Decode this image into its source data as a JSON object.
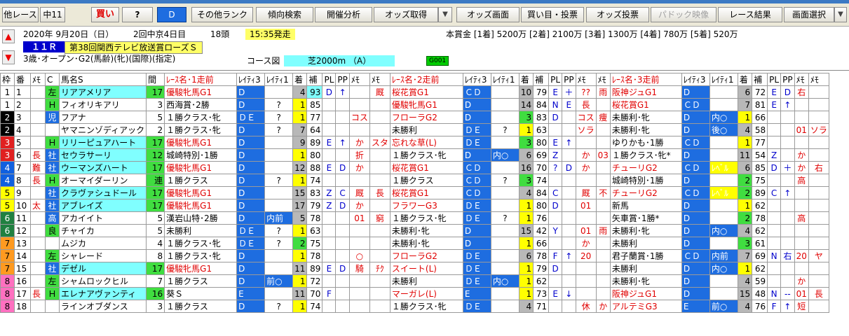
{
  "toolbar": {
    "b0": "他レース",
    "b1": "中11",
    "b2": "買い",
    "b3": "?",
    "b4": "D",
    "b5": "その他ランク",
    "b6": "傾向検索",
    "b7": "開催分析",
    "b8": "オッズ取得",
    "b9": "▼",
    "b10": "オッズ画面",
    "b11": "買い目・投票",
    "b12": "オッズ投票",
    "b13": "パドック映像",
    "b14": "レース結果",
    "b15": "画面選択",
    "b16": "▼"
  },
  "race": {
    "date": "2020年 9月20日（日）",
    "meet": "2回中京4日目",
    "heads": "18頭",
    "post": "15:35発走",
    "num": "１１Ｒ",
    "name": "第38回関西テレビ放送賞ローズＳ",
    "cond": "3歳･オープン･G2(馬齢)(牝)(国際)(指定)",
    "course_lbl": "コース図",
    "course": "芝2000m （A）",
    "code": "G001",
    "prize": "本賞金 [1着] 5200万 [2着] 2100万 [3着] 1300万 [4着] 780万 [5着] 520万"
  },
  "headers": [
    "枠",
    "番",
    "ﾒﾓ",
    "C",
    "馬名S",
    "間",
    "ﾚｰｽ名･1走前",
    "ﾚｲﾃｨ3",
    "ﾚｲﾃｨ1",
    "着",
    "補",
    "PL",
    "PP",
    "ﾒﾓ",
    "ﾒﾓ",
    "ﾚｰｽ名･2走前",
    "ﾚｲﾃｨ3",
    "ﾚｲﾃｨ1",
    "着",
    "補",
    "PL",
    "PP",
    "ﾒﾓ",
    "ﾒﾓ",
    "ﾚｰｽ名･3走前",
    "ﾚｲﾃｨ3",
    "ﾚｲﾃｨ1",
    "着",
    "補",
    "PL",
    "PP",
    "ﾒﾓ",
    "ﾒﾓ"
  ],
  "rows": [
    [
      "1",
      "1",
      "",
      "左",
      "リアアメリア",
      "17",
      "優駿牝馬G1",
      "D",
      "",
      "4",
      "93",
      "D",
      "↑",
      "",
      "厩",
      "桜花賞G1",
      "ＣＤ",
      "",
      "10",
      "79",
      "E",
      "＋",
      "??",
      "雨",
      "阪神ジュG1",
      "D",
      "",
      "6",
      "72",
      "E",
      "D",
      "右",
      ""
    ],
    [
      "1",
      "2",
      "",
      "Ｈ",
      "フィオリキアリ",
      "3",
      "西海賞･2勝",
      "D",
      "?",
      "1",
      "85",
      "",
      "",
      "",
      "",
      "優駿牝馬G1",
      "D",
      "",
      "14",
      "84",
      "N",
      "E",
      "長",
      "",
      "桜花賞G1",
      "ＣＤ",
      "",
      "7",
      "81",
      "E",
      "↑",
      "",
      ""
    ],
    [
      "2",
      "3",
      "",
      "児",
      "フアナ",
      "5",
      "１勝クラス･牝",
      "ＤＥ",
      "?",
      "1",
      "77",
      "",
      "",
      "コス",
      "",
      "フローラG2",
      "D",
      "",
      "3",
      "83",
      "D",
      "",
      "コス",
      "痩",
      "未勝利･牝",
      "D",
      "内○",
      "1",
      "66",
      "",
      "",
      "",
      ""
    ],
    [
      "2",
      "4",
      "",
      "",
      "ヤマニンゾディアック",
      "2",
      "１勝クラス･牝",
      "D",
      "?",
      "7",
      "64",
      "",
      "",
      "",
      "",
      "未勝利",
      "ＤＥ",
      "?",
      "1",
      "63",
      "",
      "",
      "ソラ",
      "",
      "未勝利･牝",
      "D",
      "後○",
      "4",
      "58",
      "",
      "",
      "01",
      "ソラ"
    ],
    [
      "3",
      "5",
      "",
      "Ｈ",
      "リリーピュアハート",
      "17",
      "優駿牝馬G1",
      "D",
      "",
      "9",
      "89",
      "E",
      "↑",
      "か",
      "スタ",
      "忘れな草(L)",
      "ＤＥ",
      "",
      "3",
      "80",
      "E",
      "↑",
      "",
      "",
      "ゆりかも･1勝",
      "ＣＤ",
      "",
      "1",
      "77",
      "",
      "",
      "",
      ""
    ],
    [
      "3",
      "6",
      "長",
      "社",
      "セウラサーリ",
      "12",
      "城崎特別･1勝",
      "D",
      "",
      "1",
      "80",
      "",
      "",
      "折",
      "",
      "１勝クラス･牝",
      "D",
      "内○",
      "6",
      "69",
      "Z",
      "",
      "か",
      "03",
      "１勝クラス･牝*",
      "D",
      "",
      "11",
      "54",
      "Z",
      "",
      "か",
      ""
    ],
    [
      "4",
      "7",
      "難",
      "社",
      "ウーマンズハート",
      "17",
      "優駿牝馬G1",
      "D",
      "",
      "12",
      "88",
      "E",
      "D",
      "か",
      "",
      "桜花賞G1",
      "ＣＤ",
      "",
      "16",
      "70",
      "?",
      "D",
      "か",
      "",
      "チューリG2",
      "ＣＤ",
      "ﾚﾍﾞﾙ",
      "6",
      "85",
      "D",
      "＋",
      "か",
      "右"
    ],
    [
      "4",
      "8",
      "長",
      "Ｈ",
      "オーマイダーリン",
      "連",
      "１勝クラス",
      "D",
      "?",
      "1",
      "74",
      "",
      "",
      "",
      "",
      "１勝クラス",
      "ＣＤ",
      "?",
      "3",
      "74",
      "",
      "",
      "",
      "",
      "城崎特別･1勝",
      "D",
      "",
      "2",
      "75",
      "",
      "",
      "高",
      ""
    ],
    [
      "5",
      "9",
      "",
      "社",
      "クラヴァシュドール",
      "17",
      "優駿牝馬G1",
      "D",
      "",
      "15",
      "83",
      "Z",
      "C",
      "厩",
      "長",
      "桜花賞G1",
      "ＣＤ",
      "",
      "4",
      "84",
      "C",
      "",
      "厩",
      "不",
      "チューリG2",
      "ＣＤ",
      "ﾚﾍﾞﾙ",
      "2",
      "89",
      "C",
      "↑",
      "",
      ""
    ],
    [
      "5",
      "10",
      "太",
      "社",
      "アブレイズ",
      "17",
      "優駿牝馬G1",
      "D",
      "",
      "17",
      "79",
      "Z",
      "D",
      "か",
      "",
      "フラワーG3",
      "ＤＥ",
      "",
      "1",
      "80",
      "D",
      "",
      "01",
      "",
      "新馬",
      "D",
      "",
      "1",
      "62",
      "",
      "",
      "",
      ""
    ],
    [
      "6",
      "11",
      "",
      "高",
      "アカイイト",
      "5",
      "漢岩山特･2勝",
      "D",
      "内前",
      "5",
      "78",
      "",
      "",
      "01",
      "窮",
      "１勝クラス･牝",
      "ＤＥ",
      "?",
      "1",
      "76",
      "",
      "",
      "",
      "",
      "矢車賞･1勝*",
      "D",
      "",
      "2",
      "78",
      "",
      "",
      "高",
      ""
    ],
    [
      "6",
      "12",
      "",
      "良",
      "チャイカ",
      "5",
      "未勝利",
      "ＤＥ",
      "?",
      "1",
      "63",
      "",
      "",
      "",
      "",
      "未勝利･牝",
      "D",
      "",
      "15",
      "42",
      "Y",
      "",
      "01",
      "雨",
      "未勝利･牝",
      "D",
      "内○",
      "4",
      "62",
      "",
      "",
      "",
      ""
    ],
    [
      "7",
      "13",
      "",
      "",
      "ムジカ",
      "4",
      "１勝クラス･牝",
      "ＤＥ",
      "?",
      "2",
      "75",
      "",
      "",
      "",
      "",
      "未勝利･牝",
      "D",
      "",
      "1",
      "66",
      "",
      "",
      "か",
      "",
      "未勝利",
      "D",
      "",
      "3",
      "61",
      "",
      "",
      "",
      ""
    ],
    [
      "7",
      "14",
      "",
      "左",
      "シャレード",
      "8",
      "１勝クラス･牝",
      "D",
      "",
      "1",
      "78",
      "",
      "",
      "○",
      "",
      "フローラG2",
      "ＤＥ",
      "",
      "6",
      "78",
      "F",
      "↑",
      "20",
      "",
      "君子蘭賞･1勝",
      "ＣＤ",
      "内前",
      "7",
      "69",
      "N",
      "右",
      "20",
      "ヤ"
    ],
    [
      "7",
      "15",
      "",
      "社",
      "デゼル",
      "17",
      "優駿牝馬G1",
      "D",
      "",
      "11",
      "89",
      "E",
      "D",
      "騎",
      "ﾁｸ",
      "スイート(L)",
      "ＤＥ",
      "",
      "1",
      "79",
      "D",
      "",
      "",
      "",
      "未勝利",
      "D",
      "内○",
      "1",
      "62",
      "",
      "",
      "",
      ""
    ],
    [
      "8",
      "16",
      "",
      "左",
      "シャムロックヒル",
      "7",
      "１勝クラス",
      "D",
      "前○",
      "1",
      "72",
      "",
      "",
      "",
      "",
      "未勝利",
      "ＤＥ",
      "内○",
      "1",
      "62",
      "",
      "",
      "",
      "",
      "未勝利･牝",
      "D",
      "",
      "4",
      "59",
      "",
      "",
      "か",
      ""
    ],
    [
      "8",
      "17",
      "長",
      "Ｈ",
      "エレナアヴァンティ",
      "16",
      "葵Ｓ",
      "E",
      "",
      "11",
      "70",
      "F",
      "",
      "",
      "",
      "マーガレ(L)",
      "E",
      "",
      "1",
      "73",
      "E",
      "↓",
      "",
      "",
      "阪神ジュG1",
      "D",
      "",
      "15",
      "48",
      "N",
      "--",
      "01",
      "長"
    ],
    [
      "8",
      "18",
      "",
      "",
      "ラインオブダンス",
      "3",
      "１勝クラス",
      "D",
      "?",
      "1",
      "74",
      "",
      "",
      "",
      "",
      "１勝クラス･牝",
      "ＤＥ",
      "",
      "4",
      "71",
      "",
      "",
      "休",
      "か",
      "アルテミG3",
      "E",
      "前○",
      "4",
      "76",
      "F",
      "↑",
      "短",
      ""
    ]
  ],
  "colors": {
    "accent": "#1e6de0",
    "frame": [
      "#ffffff",
      "#000000",
      "#e02020",
      "#1060e0",
      "#ffff00",
      "#208040",
      "#ff9a20",
      "#ff70c0"
    ]
  }
}
